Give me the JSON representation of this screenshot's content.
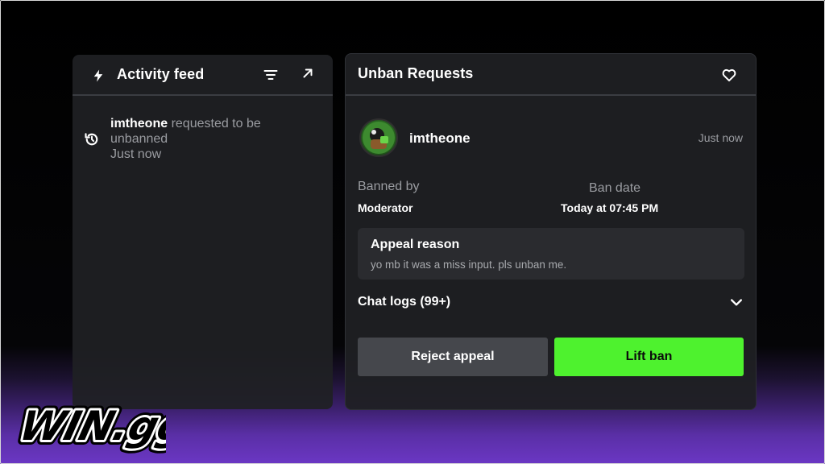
{
  "activity_feed": {
    "title": "Activity feed",
    "icons": {
      "bolt": "lightning-icon",
      "filter": "filter-icon",
      "expand": "arrow-up-right-icon"
    },
    "items": [
      {
        "icon": "history-icon",
        "user": "imtheone",
        "action": " requested to be unbanned",
        "time": "Just now"
      }
    ]
  },
  "unban_requests": {
    "title": "Unban Requests",
    "favorite_icon": "heart-icon",
    "request": {
      "username": "imtheone",
      "time": "Just now",
      "banned_by_label": "Banned by",
      "banned_by_value": "Moderator",
      "ban_date_label": "Ban date",
      "ban_date_value": "Today at 07:45 PM",
      "appeal_title": "Appeal reason",
      "appeal_text": "yo mb it was a miss input. pls unban me.",
      "chat_logs_label": "Chat logs (99+)"
    },
    "buttons": {
      "reject": "Reject appeal",
      "lift": "Lift ban"
    }
  },
  "brand": {
    "logo_text": "WIN.gg"
  },
  "colors": {
    "panel": "#1f2023",
    "accent_green": "#4ef22e",
    "purple": "#6b37c4",
    "muted_text": "#9a9ca1"
  }
}
